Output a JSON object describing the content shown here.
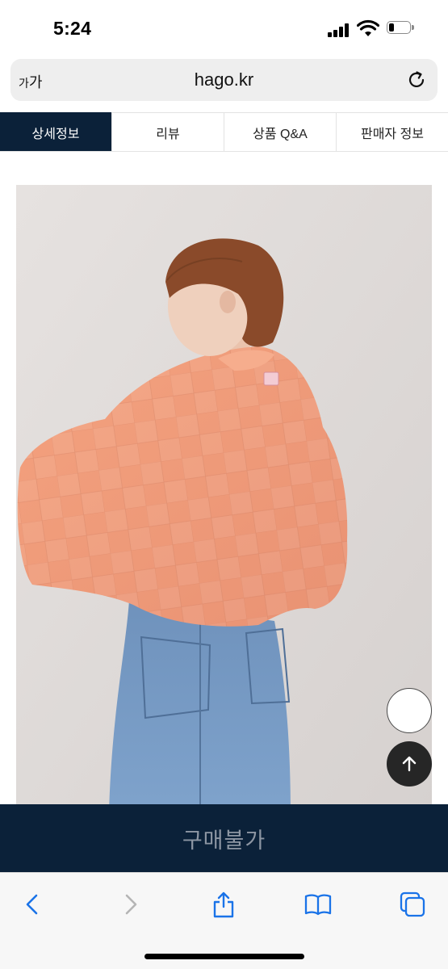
{
  "status_bar": {
    "time": "5:24",
    "icons": [
      "cellular-signal-icon",
      "wifi-icon",
      "battery-icon"
    ],
    "battery_level": 0.25
  },
  "browser": {
    "text_size_label_small": "가",
    "text_size_label_large": "가",
    "url": "hago.kr",
    "reload_icon": "reload-icon"
  },
  "tabs": [
    {
      "label": "상세정보",
      "active": true
    },
    {
      "label": "리뷰",
      "active": false
    },
    {
      "label": "상품 Q&A",
      "active": false
    },
    {
      "label": "판매자 정보",
      "active": false
    }
  ],
  "product": {
    "image_icon": "product-photo-knit-bolero"
  },
  "floating": {
    "scroll_top_icon": "arrow-up-icon"
  },
  "purchase": {
    "label": "구매불가"
  },
  "toolbar": {
    "icons": [
      "back-chevron-icon",
      "forward-chevron-icon",
      "share-icon",
      "bookmarks-icon",
      "tabs-icon"
    ]
  },
  "colors": {
    "navy": "#0b2139",
    "buy_text": "#8d96a3",
    "safari_blue": "#1a73e8"
  }
}
